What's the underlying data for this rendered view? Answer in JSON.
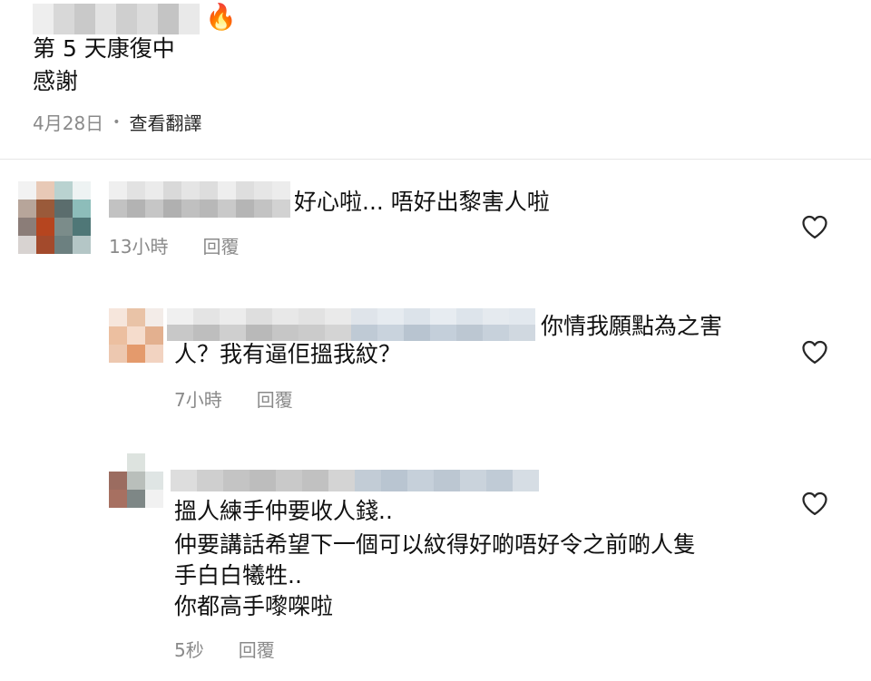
{
  "post": {
    "fire_emoji": "🔥",
    "line1": "第 5 天康復中",
    "line2": "感謝",
    "date": "4月28日",
    "dot": "•",
    "translate": "查看翻譯"
  },
  "comments": [
    {
      "text": "好心啦... 唔好出黎害人啦",
      "time": "13小時",
      "reply": "回覆",
      "like_icon": "heart-outline-icon"
    },
    {
      "text_line1": "你情我願點為之害",
      "text_line2": "人？我有逼佢搵我紋？",
      "time": "7小時",
      "reply": "回覆",
      "like_icon": "heart-outline-icon"
    },
    {
      "lines": [
        "搵人練手仲要收人錢..",
        "仲要講話希望下一個可以紋得好啲唔好令之前啲人隻",
        "手白白犧牲..",
        "你都高手嚟㗎啦"
      ],
      "time": "5秒",
      "reply": "回覆",
      "like_icon": "heart-outline-icon"
    }
  ],
  "colors": {
    "text": "#111111",
    "meta": "#8a8a8a",
    "divider": "#e6e6e6"
  }
}
